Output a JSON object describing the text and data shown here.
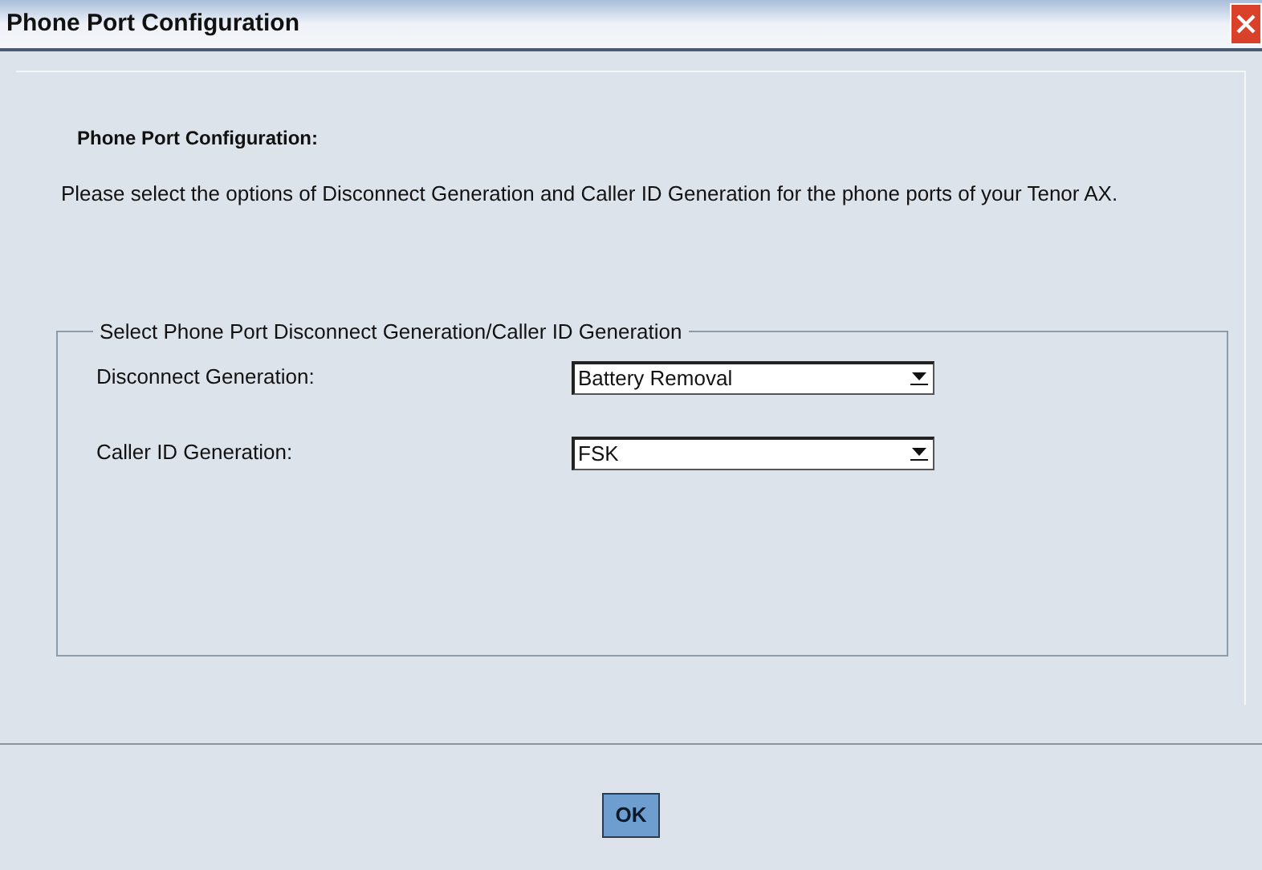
{
  "window": {
    "title": "Phone Port Configuration"
  },
  "heading": "Phone Port Configuration:",
  "description": "Please select the options of Disconnect Generation and Caller ID Generation for the phone ports of your Tenor AX.",
  "group": {
    "title": "Select Phone Port Disconnect Generation/Caller ID Generation",
    "fields": [
      {
        "label": "Disconnect Generation:",
        "value": "Battery Removal"
      },
      {
        "label": "Caller ID Generation:",
        "value": "FSK"
      }
    ]
  },
  "buttons": [
    "OK"
  ]
}
